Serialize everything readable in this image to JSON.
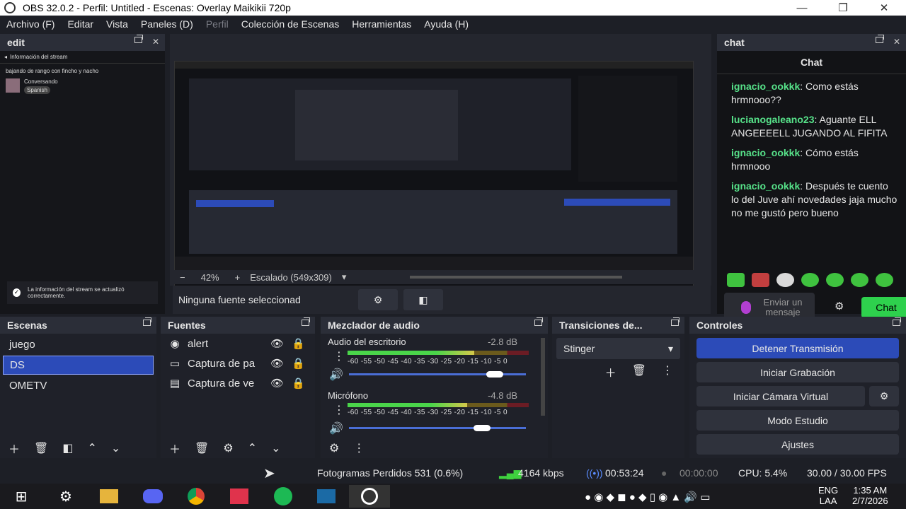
{
  "window": {
    "title": "OBS 32.0.2 - Perfil: Untitled - Escenas: Overlay Maikikii 720p",
    "min": "—",
    "max": "❐",
    "close": "✕"
  },
  "menu": [
    "Archivo (F)",
    "Editar",
    "Vista",
    "Paneles (D)",
    "Perfil",
    "Colección de Escenas",
    "Herramientas",
    "Ayuda (H)"
  ],
  "edit_dock": {
    "title": "edit",
    "stream_info": "Información del stream",
    "stream_title": "bajando de rango con fincho y nacho",
    "category": "Conversando",
    "tag": "Spanish",
    "notice": "La información del stream se actualizó correctamente."
  },
  "preview": {
    "zoom": "42%",
    "scale": "Escalado (549x309)",
    "no_source": "Ninguna fuente seleccionad"
  },
  "chat_dock": {
    "title": "chat",
    "header": "Chat",
    "messages": [
      {
        "user": "ignacio_ookkk",
        "text": "Como estás hrmnooo??"
      },
      {
        "user": "lucianogaleano23",
        "text": "Aguante ELL ANGEEEELL JUGANDO AL FIFITA"
      },
      {
        "user": "ignacio_ookkk",
        "text": "Cómo estás hrmnooo"
      },
      {
        "user": "ignacio_ookkk",
        "text": "Después te cuento lo del Juve ahí novedades jaja mucho no me gustó pero bueno"
      }
    ],
    "input_placeholder": "Enviar un mensaje",
    "send": "Chat"
  },
  "scenes": {
    "title": "Escenas",
    "items": [
      "juego",
      "DS",
      "OMETV"
    ],
    "selected": 1
  },
  "sources": {
    "title": "Fuentes",
    "items": [
      {
        "icon": "alert-icon",
        "name": "alert"
      },
      {
        "icon": "monitor-icon",
        "name": "Captura de pa"
      },
      {
        "icon": "window-icon",
        "name": "Captura de ve"
      }
    ]
  },
  "mixer": {
    "title": "Mezclador de audio",
    "tracks": [
      {
        "name": "Audio del escritorio",
        "db": "-2.8 dB",
        "level": 0.7,
        "volume": 0.86
      },
      {
        "name": "Micrófono",
        "db": "-4.8 dB",
        "level": 0.66,
        "volume": 0.78
      }
    ],
    "ticks": "-60 -55 -50 -45 -40 -35 -30 -25 -20 -15 -10  -5  0"
  },
  "transitions": {
    "title": "Transiciones de...",
    "selected": "Stinger"
  },
  "controls": {
    "title": "Controles",
    "buttons": [
      "Detener Transmisión",
      "Iniciar Grabación",
      "Iniciar Cámara Virtual",
      "Modo Estudio",
      "Ajustes"
    ]
  },
  "status": {
    "dropped": "Fotogramas Perdidos 531 (0.6%)",
    "bitrate": "4164 kbps",
    "stream_time": "00:53:24",
    "rec_time": "00:00:00",
    "cpu": "CPU: 5.4%",
    "fps": "30.00 / 30.00 FPS"
  },
  "taskbar": {
    "lang": "ENG",
    "layout": "LAA",
    "time": "1:35 AM",
    "date": "2/7/2026"
  },
  "colors": {
    "accent": "#2c4bb8",
    "chat_user": "#57e38a",
    "send": "#2ed14d"
  }
}
